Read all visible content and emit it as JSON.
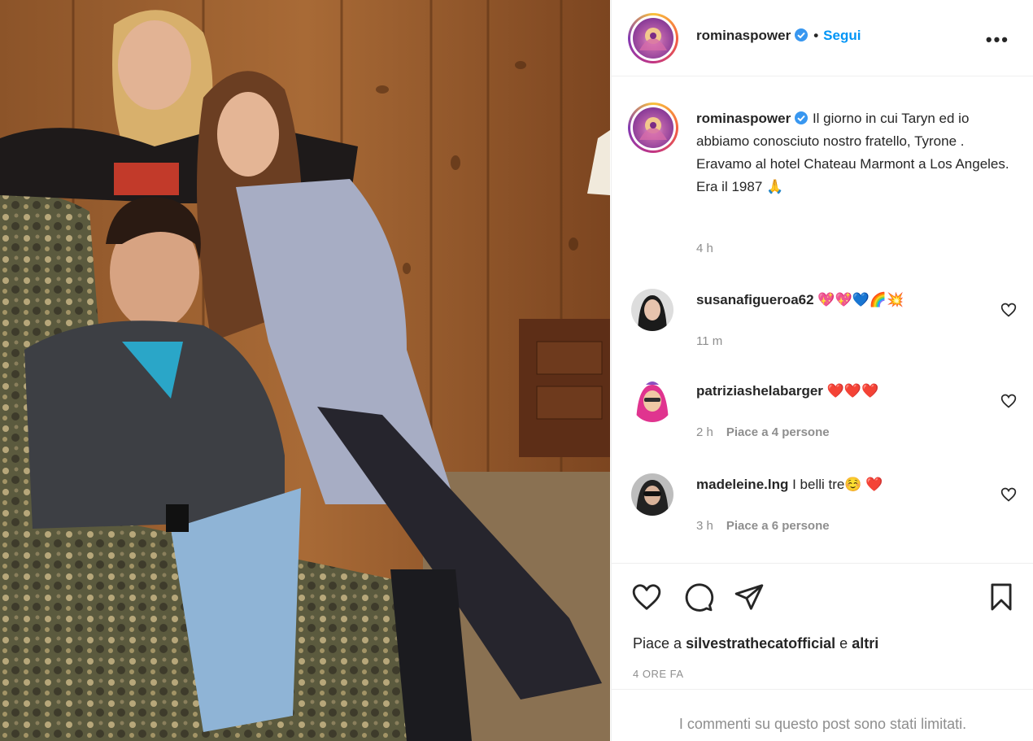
{
  "post": {
    "username": "rominaspower",
    "verified": true,
    "separator": "•",
    "follow_label": "Segui",
    "more_label": "•••",
    "caption": "Il giorno in cui Taryn ed io abbiamo conosciuto nostro fratello, Tyrone . Eravamo al hotel Chateau Marmont a Los Angeles. Era il 1987 🙏",
    "caption_time": "4 h"
  },
  "comments": [
    {
      "username": "susanafigueroa62",
      "text": "💖💖💙🌈💥",
      "time": "11 m",
      "likes": ""
    },
    {
      "username": "patriziashelabarger",
      "text": "❤️❤️❤️",
      "time": "2 h",
      "likes": "Piace a 4 persone"
    },
    {
      "username": "madeleine.lng",
      "text": "I belli tre☺️ ❤️",
      "time": "3 h",
      "likes": "Piace a 6 persone"
    }
  ],
  "footer": {
    "likes_prefix": "Piace a",
    "likes_user": "silvestrathecatofficial",
    "likes_joiner": "e",
    "likes_others": "altri",
    "posted_time": "4 ORE FA",
    "comments_limited": "I commenti su questo post sono stati limitati."
  },
  "icons": {
    "like": "heart-icon",
    "comment": "comment-icon",
    "share": "paper-plane-icon",
    "save": "bookmark-icon",
    "verified": "verified-badge-icon"
  },
  "colors": {
    "link_blue": "#0095f6",
    "verified_blue": "#3897f0",
    "muted_text": "#8e8e8e",
    "border": "#efefef"
  }
}
